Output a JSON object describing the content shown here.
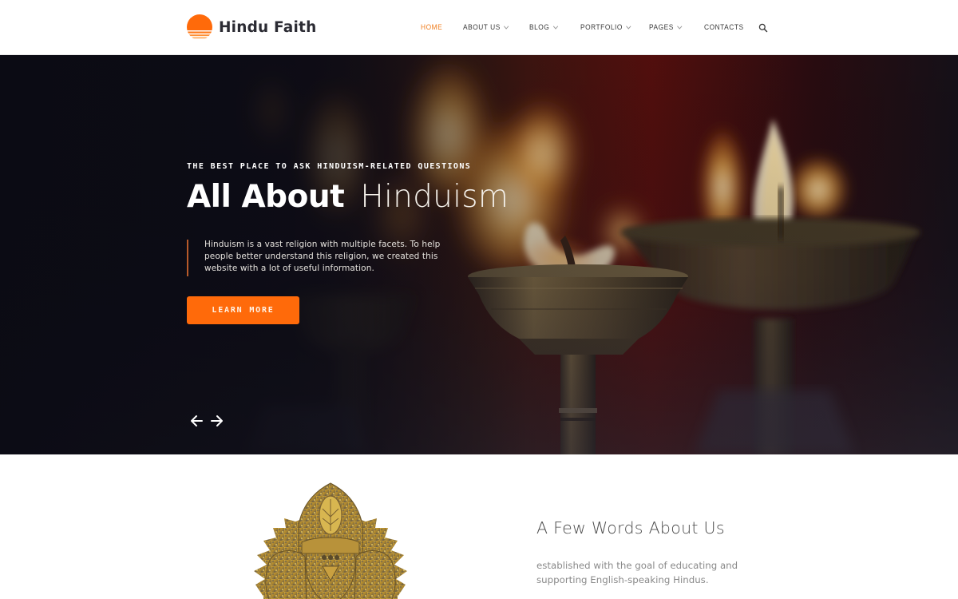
{
  "brand": {
    "name": "Hindu Faith",
    "logo_icon": "sunset-icon",
    "accent_color": "#f07c1b",
    "button_color": "#ff6a0a"
  },
  "nav": {
    "items": [
      {
        "label": "HOME",
        "active": true,
        "has_dropdown": false
      },
      {
        "label": "ABOUT US",
        "active": false,
        "has_dropdown": true
      },
      {
        "label": "BLOG",
        "active": false,
        "has_dropdown": true
      },
      {
        "label": "PORTFOLIO",
        "active": false,
        "has_dropdown": true
      },
      {
        "label": "PAGES",
        "active": false,
        "has_dropdown": true
      },
      {
        "label": "CONTACTS",
        "active": false,
        "has_dropdown": false
      }
    ],
    "search_icon": "search-icon"
  },
  "hero": {
    "eyebrow": "THE BEST PLACE TO ASK HINDUISM-RELATED QUESTIONS",
    "title_bold": "All About",
    "title_light": "Hinduism",
    "description": "Hinduism is a vast religion with multiple facets. To help people better understand this religion, we created this website with a lot of useful information.",
    "cta_label": "LEARN MORE",
    "prev_icon": "arrow-left-icon",
    "next_icon": "arrow-right-icon",
    "background": "brass oil lamps with flames"
  },
  "about": {
    "title": "A Few Words About Us",
    "text": "established with the goal of educating and supporting English-speaking Hindus.",
    "image": "golden ganesha statue"
  }
}
